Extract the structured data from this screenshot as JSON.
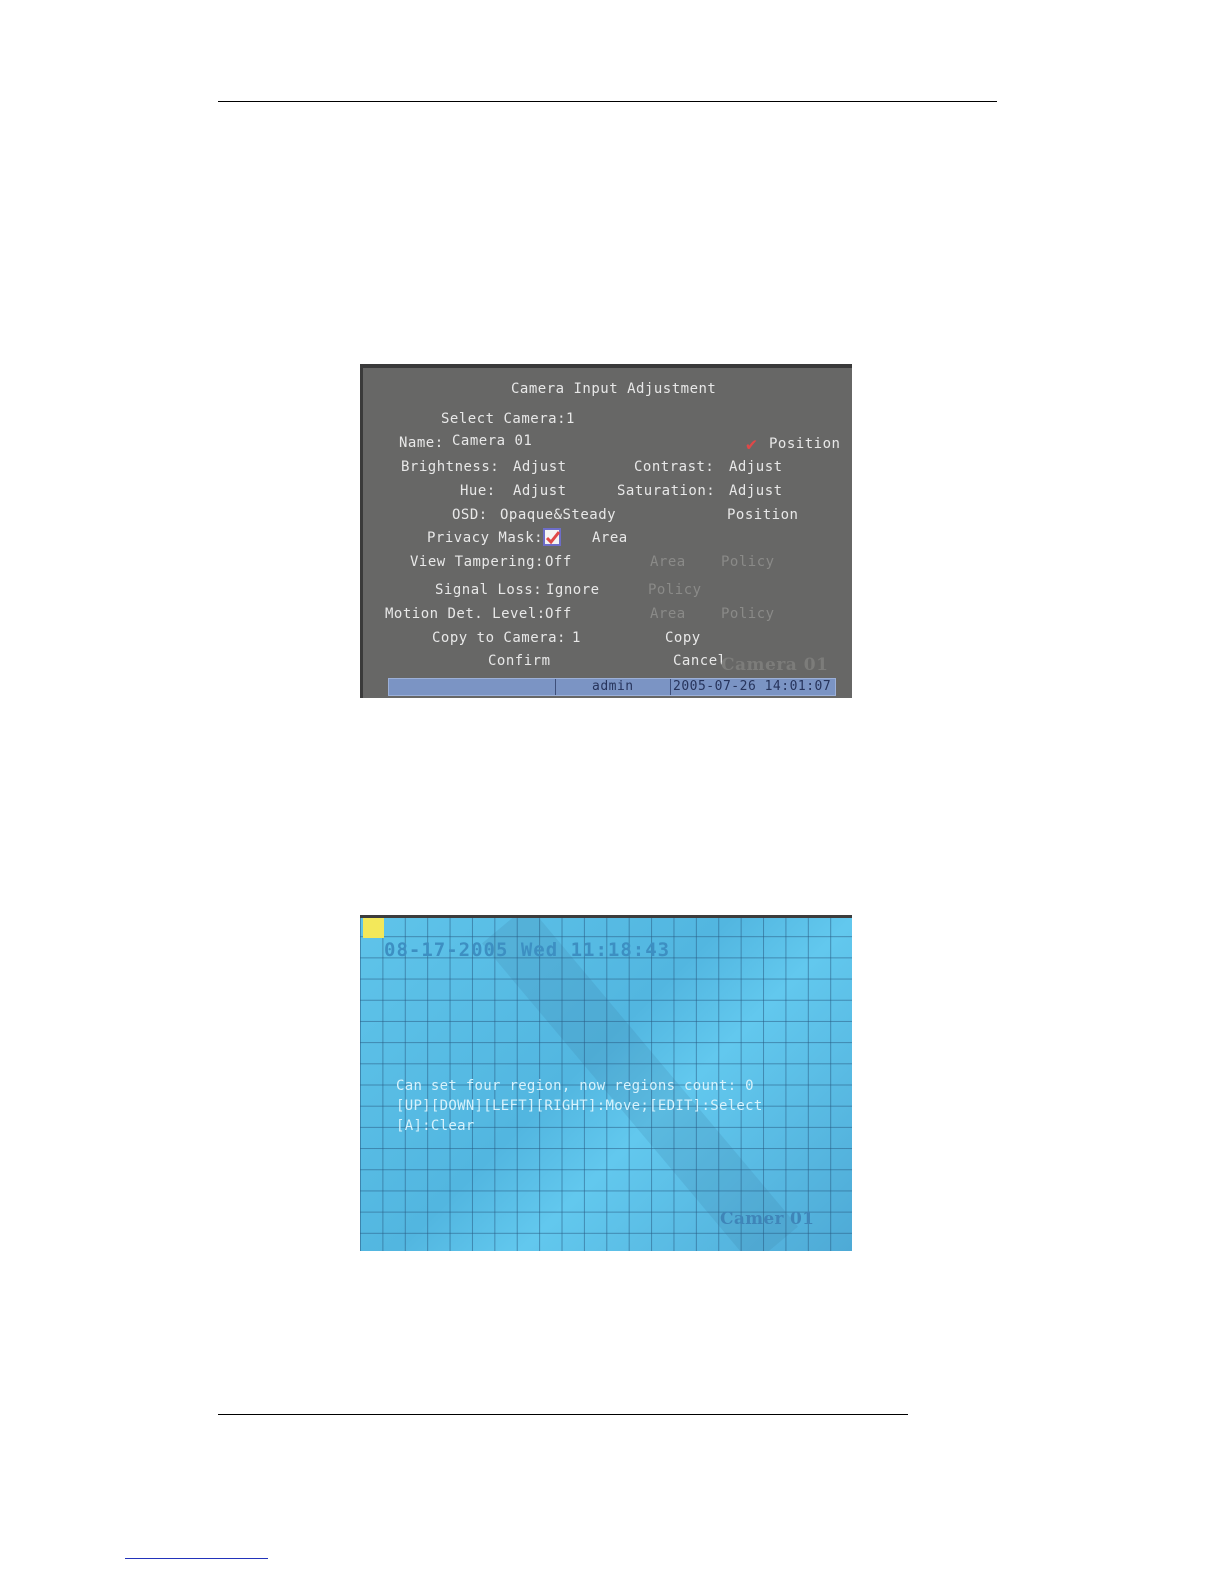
{
  "menu": {
    "title": "Camera Input Adjustment",
    "select_camera": "Select Camera:1",
    "name_label": "Name:",
    "name_value": "Camera 01",
    "position_top": "Position",
    "brightness_label": "Brightness:",
    "brightness_value": "Adjust",
    "contrast_label": "Contrast:",
    "contrast_value": "Adjust",
    "hue_label": "Hue:",
    "hue_value": "Adjust",
    "saturation_label": "Saturation:",
    "saturation_value": "Adjust",
    "osd_label": "OSD:",
    "osd_value": "Opaque&Steady",
    "osd_position": "Position",
    "privacy_label": "Privacy Mask:",
    "privacy_checked": true,
    "privacy_area": "Area",
    "view_tampering_label": "View Tampering:",
    "view_tampering_value": "Off",
    "vt_area": "Area",
    "vt_policy": "Policy",
    "signal_loss_label": "Signal Loss:",
    "signal_loss_value": "Ignore",
    "sl_policy": "Policy",
    "motion_label": "Motion Det. Level:",
    "motion_value": "Off",
    "md_area": "Area",
    "md_policy": "Policy",
    "copy_label": "Copy to Camera:",
    "copy_value": "1",
    "copy_button": "Copy",
    "confirm_button": "Confirm",
    "cancel_button": "Cancel",
    "overlay_camera": "Camera 01",
    "status_user": "admin",
    "status_datetime": "2005-07-26 14:01:07",
    "checkmark_color": "#e04848"
  },
  "mask_screen": {
    "datetime": "08-17-2005 Wed 11:18:43",
    "line1": "Can set four region, now regions count: 0",
    "line2": "[UP][DOWN][LEFT][RIGHT]:Move;[EDIT]:Select",
    "line3": "[A]:Clear",
    "camera_overlay": "Camer  01",
    "cursor_color": "#f3e85a"
  }
}
